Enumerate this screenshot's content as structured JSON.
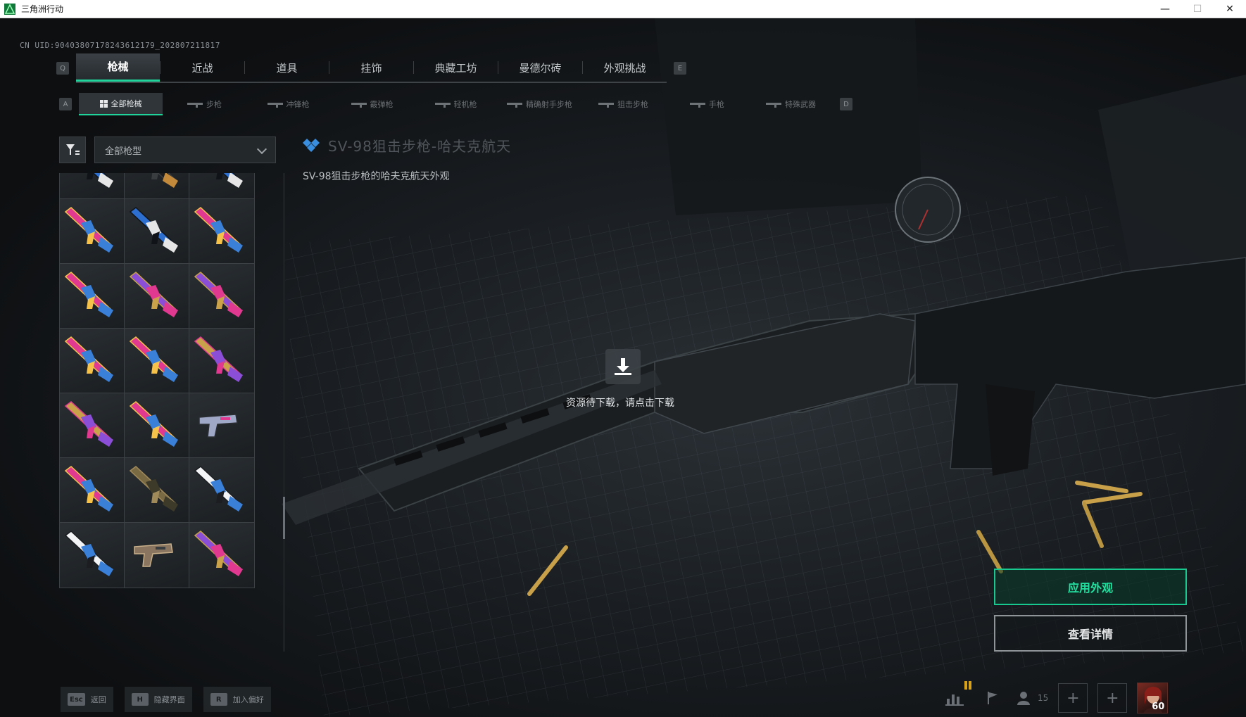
{
  "window": {
    "title": "三角洲行动",
    "minimize": "—",
    "maximize": "☐",
    "close": "✕"
  },
  "uid": "CN UID:9040380717824361217​9_202807211817",
  "tabs": {
    "left_key": "Q",
    "right_key": "E",
    "items": [
      {
        "label": "枪械",
        "active": true
      },
      {
        "label": "近战",
        "active": false
      },
      {
        "label": "道具",
        "active": false
      },
      {
        "label": "挂饰",
        "active": false
      },
      {
        "label": "典藏工坊",
        "active": false
      },
      {
        "label": "曼德尔砖",
        "active": false
      },
      {
        "label": "外观挑战",
        "active": false
      }
    ]
  },
  "subtabs": {
    "left_key": "A",
    "right_key": "D",
    "items": [
      {
        "label": "全部枪械",
        "active": true,
        "icon": "grid-icon"
      },
      {
        "label": "步枪",
        "active": false,
        "icon": "rifle-icon"
      },
      {
        "label": "冲锋枪",
        "active": false,
        "icon": "smg-icon"
      },
      {
        "label": "霰弹枪",
        "active": false,
        "icon": "shotgun-icon"
      },
      {
        "label": "轻机枪",
        "active": false,
        "icon": "lmg-icon"
      },
      {
        "label": "精确射手步枪",
        "active": false,
        "icon": "dmr-icon"
      },
      {
        "label": "狙击步枪",
        "active": false,
        "icon": "sniper-icon"
      },
      {
        "label": "手枪",
        "active": false,
        "icon": "pistol-icon"
      },
      {
        "label": "特殊武器",
        "active": false,
        "icon": "special-weapon-icon"
      }
    ]
  },
  "filter": {
    "selected": "全部枪型"
  },
  "detail": {
    "title": "SV-98狙击步枪-哈夫克航天",
    "subtitle": "SV-98狙击步枪的哈夫克航天外观"
  },
  "download": {
    "text": "资源待下载，请点击下载"
  },
  "actions": {
    "apply": "应用外观",
    "details": "查看详情"
  },
  "bottom_hints": [
    {
      "key": "Esc",
      "label": "返回"
    },
    {
      "key": "H",
      "label": "隐藏界面"
    },
    {
      "key": "R",
      "label": "加入偏好"
    }
  ],
  "status": {
    "friends_count": "15",
    "player_level": "60"
  },
  "colors": {
    "accent": "#1fd39a",
    "pink": "#e0398f",
    "blue": "#3a7fd8",
    "purple": "#8a4fd6",
    "gold": "#c9a24a"
  },
  "skins": [
    "blue",
    "black",
    "blue",
    "pink",
    "blue",
    "pink",
    "pink",
    "purple",
    "purple",
    "pink",
    "pink",
    "gold",
    "gold",
    "pink",
    "revolver",
    "pink",
    "camo",
    "white",
    "white",
    "pistol",
    "purple"
  ]
}
